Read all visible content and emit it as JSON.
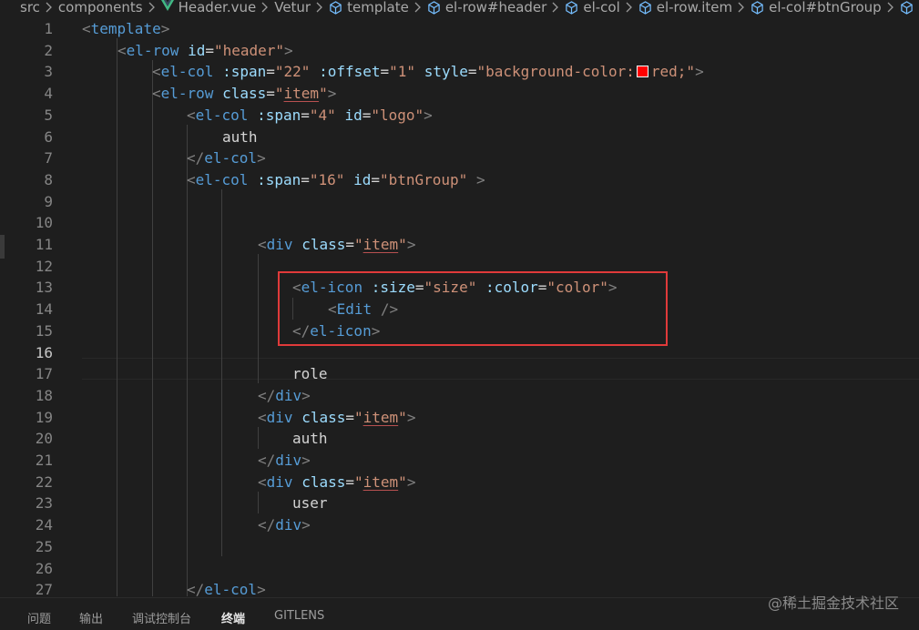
{
  "breadcrumb": {
    "items": [
      "src",
      "components",
      "Header.vue",
      "Vetur",
      "template",
      "el-row#header",
      "el-col",
      "el-row.item",
      "el-col#btnGroup"
    ]
  },
  "editor": {
    "current_line": "16",
    "line_numbers": [
      "1",
      "2",
      "3",
      "4",
      "5",
      "6",
      "7",
      "8",
      "9",
      "10",
      "11",
      "12",
      "13",
      "14",
      "15",
      "16",
      "17",
      "18",
      "19",
      "20",
      "21",
      "22",
      "23",
      "24",
      "25",
      "26",
      "27"
    ],
    "swatch_color": "#ff0000",
    "lines": {
      "l1": {
        "open": "<",
        "tag": "template",
        "close": ">"
      },
      "l2": {
        "open": "<",
        "tag": "el-row",
        "attr1": "id",
        "eq1": "=",
        "val1": "\"header\"",
        "close": ">"
      },
      "l3": {
        "open": "<",
        "tag": "el-col",
        "attr1": ":span",
        "eq1": "=",
        "val1": "\"22\"",
        "attr2": ":offset",
        "eq2": "=",
        "val2": "\"1\"",
        "attr3": "style",
        "eq3": "=",
        "val3a": "\"background-color:",
        "val3b": "red;\"",
        "close": ">"
      },
      "l4": {
        "open": "<",
        "tag": "el-row",
        "attr1": "class",
        "eq1": "=",
        "q1": "\"",
        "val1": "item",
        "q2": "\"",
        "close": ">"
      },
      "l5": {
        "open": "<",
        "tag": "el-col",
        "attr1": ":span",
        "eq1": "=",
        "val1": "\"4\"",
        "attr2": "id",
        "eq2": "=",
        "val2": "\"logo\"",
        "close": ">"
      },
      "l6": {
        "text": "auth"
      },
      "l7": {
        "open": "</",
        "tag": "el-col",
        "close": ">"
      },
      "l8": {
        "open": "<",
        "tag": "el-col",
        "attr1": ":span",
        "eq1": "=",
        "val1": "\"16\"",
        "attr2": "id",
        "eq2": "=",
        "val2": "\"btnGroup\"",
        "close": ">"
      },
      "l11": {
        "open": "<",
        "tag": "div",
        "attr1": "class",
        "eq1": "=",
        "q1": "\"",
        "val1": "item",
        "q2": "\"",
        "close": ">"
      },
      "l13": {
        "open": "<",
        "tag": "el-icon",
        "attr1": ":size",
        "eq1": "=",
        "val1": "\"size\"",
        "attr2": ":color",
        "eq2": "=",
        "val2": "\"color\"",
        "close": ">"
      },
      "l14": {
        "open": "<",
        "tag": "Edit",
        "close": "/>"
      },
      "l15": {
        "open": "</",
        "tag": "el-icon",
        "close": ">"
      },
      "l17": {
        "text": "role"
      },
      "l18": {
        "open": "</",
        "tag": "div",
        "close": ">"
      },
      "l19": {
        "open": "<",
        "tag": "div",
        "attr1": "class",
        "eq1": "=",
        "q1": "\"",
        "val1": "item",
        "q2": "\"",
        "close": ">"
      },
      "l20": {
        "text": "auth"
      },
      "l21": {
        "open": "</",
        "tag": "div",
        "close": ">"
      },
      "l22": {
        "open": "<",
        "tag": "div",
        "attr1": "class",
        "eq1": "=",
        "q1": "\"",
        "val1": "item",
        "q2": "\"",
        "close": ">"
      },
      "l23": {
        "text": "user"
      },
      "l24": {
        "open": "</",
        "tag": "div",
        "close": ">"
      },
      "l27": {
        "open": "</",
        "tag": "el-col",
        "close": ">"
      }
    }
  },
  "panel": {
    "tabs": [
      "问题",
      "输出",
      "调试控制台",
      "终端",
      "GITLENS"
    ],
    "active_tab": "终端"
  },
  "watermark": "@稀土掘金技术社区",
  "colors": {
    "background": "#1e1e1e",
    "highlight_box": "#e03a3a"
  },
  "icons": [
    "chevron-right-icon",
    "vue-logo-icon",
    "cube-symbol-icon"
  ]
}
